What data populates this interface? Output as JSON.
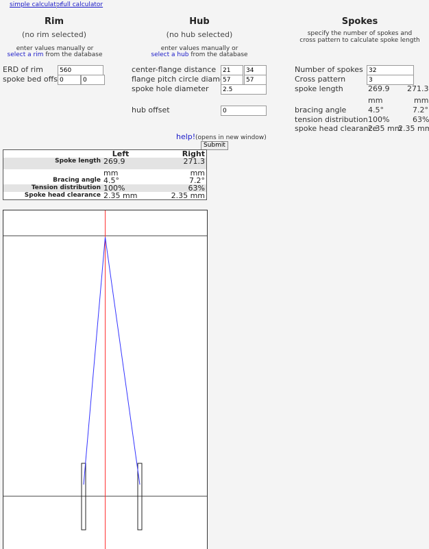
{
  "nav": {
    "simple": "simple calculator",
    "full": "full calculator"
  },
  "rim": {
    "title": "Rim",
    "none": "(no rim selected)",
    "hint1": "enter values manually or",
    "select_link": "select a rim",
    "hint2": " from the database",
    "erd_label": "ERD of rim",
    "erd_value": "560",
    "bed_label": "spoke bed offset",
    "bed_left": "0",
    "bed_right": "0"
  },
  "hub": {
    "title": "Hub",
    "none": "(no hub selected)",
    "hint1": "enter values manually or",
    "select_link": "select a hub",
    "hint2": " from the database",
    "cfd_label": "center-flange distance",
    "cfd_left": "21",
    "cfd_right": "34",
    "pcd_label": "flange pitch circle diameter",
    "pcd_left": "57",
    "pcd_right": "57",
    "shd_label": "spoke hole diameter",
    "shd_value": "2.5",
    "offset_label": "hub offset",
    "offset_value": "0"
  },
  "spokes": {
    "title": "Spokes",
    "desc1": "specify the number of spokes and",
    "desc2": "cross pattern to calculate spoke length",
    "num_label": "Number of spokes",
    "num_value": "32",
    "cross_label": "Cross pattern",
    "cross_value": "3",
    "len_label": "spoke length",
    "len_left": "269.9",
    "len_right": "271.3",
    "unit_left": "mm",
    "unit_right": "mm",
    "brace_label": "bracing angle",
    "brace_left": "4.5°",
    "brace_right": "7.2°",
    "tension_label": "tension distribution",
    "tension_left": "100%",
    "tension_right": "63%",
    "head_label": "spoke head clearance",
    "head_left": "2.35 mm",
    "head_right": "2.35 mm"
  },
  "help": {
    "link": "help!",
    "note": "(opens in new window)"
  },
  "submit": "Submit",
  "result": {
    "col_left": "Left",
    "col_right": "Right",
    "rows": [
      {
        "label": "Spoke length",
        "left": "269.9",
        "right": "271.3"
      },
      {
        "label": "",
        "left": "mm",
        "right": "mm"
      },
      {
        "label": "Bracing angle",
        "left": "4.5°",
        "right": "7.2°"
      },
      {
        "label": "Tension distribution",
        "left": "100%",
        "right": "63%"
      },
      {
        "label": "Spoke head clearance",
        "left": "2.35 mm",
        "right": "2.35 mm"
      }
    ]
  },
  "colors": {
    "link": "#1a1ac8",
    "spoke": "#3333ff",
    "axis": "#ff3333"
  }
}
